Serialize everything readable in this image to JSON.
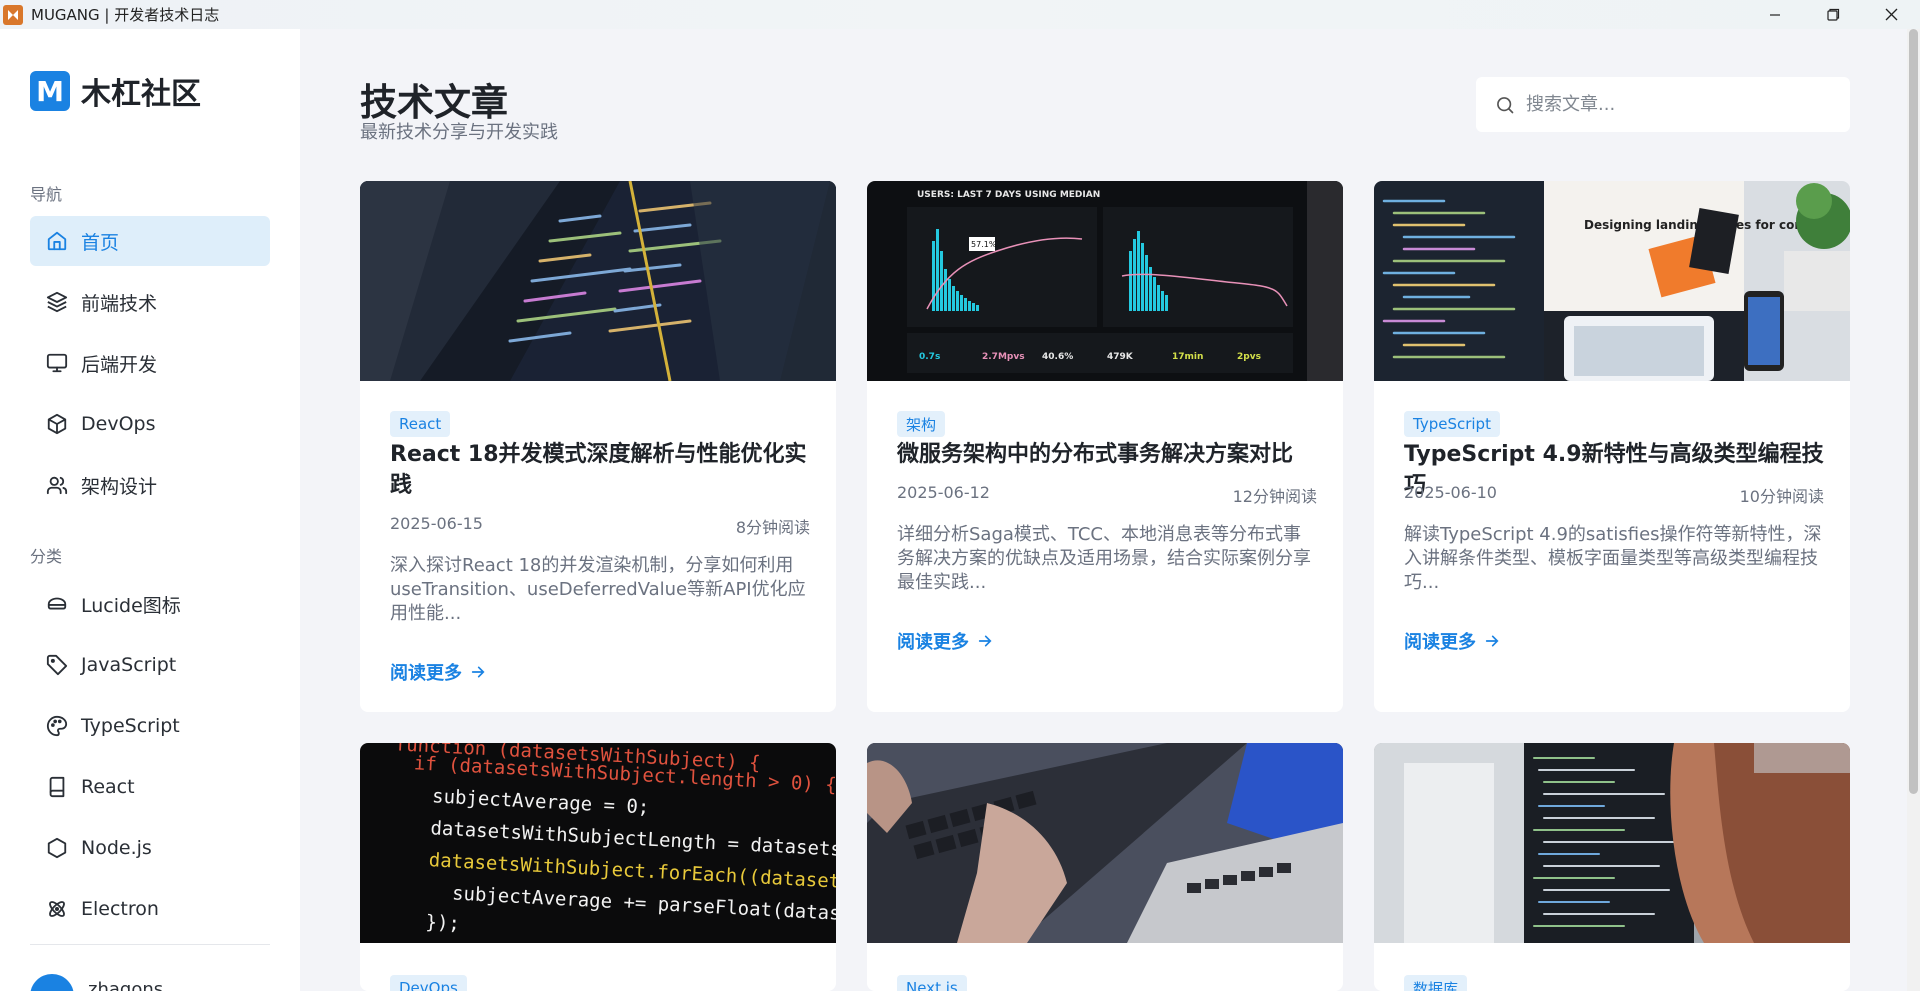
{
  "window": {
    "title": "MUGANG | 开发者技术日志"
  },
  "brand": {
    "logo_letter": "M",
    "name": "木杠社区",
    "accent": "#1a82e2"
  },
  "sidebar": {
    "nav_heading": "导航",
    "nav_items": [
      {
        "label": "首页",
        "icon": "home-icon",
        "active": true
      },
      {
        "label": "前端技术",
        "icon": "layers-icon"
      },
      {
        "label": "后端开发",
        "icon": "monitor-icon"
      },
      {
        "label": "DevOps",
        "icon": "box-icon"
      },
      {
        "label": "架构设计",
        "icon": "users-icon"
      }
    ],
    "category_heading": "分类",
    "category_items": [
      {
        "label": "Lucide图标",
        "icon": "glasses-icon"
      },
      {
        "label": "JavaScript",
        "icon": "tag-icon"
      },
      {
        "label": "TypeScript",
        "icon": "palette-icon"
      },
      {
        "label": "React",
        "icon": "book-icon"
      },
      {
        "label": "Node.js",
        "icon": "hexagon-icon"
      },
      {
        "label": "Electron",
        "icon": "atom-icon"
      }
    ],
    "user": {
      "name": "zhagons"
    }
  },
  "main": {
    "title": "技术文章",
    "subtitle": "最新技术分享与开发实践",
    "search_placeholder": "搜索文章...",
    "read_more_label": "阅读更多",
    "articles": [
      {
        "tag": "React",
        "title": "React 18并发模式深度解析与性能优化实践",
        "date": "2025-06-15",
        "read_time": "8分钟阅读",
        "excerpt": "深入探讨React 18的并发渲染机制，分享如何利用useTransition、useDeferredValue等新API优化应用性能..."
      },
      {
        "tag": "架构",
        "title": "微服务架构中的分布式事务解决方案对比",
        "date": "2025-06-12",
        "read_time": "12分钟阅读",
        "excerpt": "详细分析Saga模式、TCC、本地消息表等分布式事务解决方案的优缺点及适用场景，结合实际案例分享最佳实践..."
      },
      {
        "tag": "TypeScript",
        "title": "TypeScript 4.9新特性与高级类型编程技巧",
        "date": "2025-06-10",
        "read_time": "10分钟阅读",
        "excerpt": "解读TypeScript 4.9的satisfies操作符等新特性，深入讲解条件类型、模板字面量类型等高级类型编程技巧..."
      },
      {
        "tag": "DevOps"
      },
      {
        "tag": "Next.js"
      },
      {
        "tag": "数据库"
      }
    ],
    "code_snippet": [
      "function (datasetsWithSubject) {",
      "if (datasetsWithSubject.length > 0) {",
      "subjectAverage = 0;",
      "datasetsWithSubjectLength = datasetsWithSu",
      "datasetsWithSubject.forEach((dataset) => {",
      "subjectAverage += parseFloat(dataset[",
      "});"
    ],
    "dashboard_text": {
      "header": "USERS: LAST 7 DAYS USING MEDIAN",
      "badge": "57.1%",
      "metrics": [
        "0.7s",
        "2.7Mpvs",
        "40.6%",
        "479K",
        "17min",
        "2pvs"
      ]
    },
    "landing_text": "Designing landing pages for conversion"
  }
}
